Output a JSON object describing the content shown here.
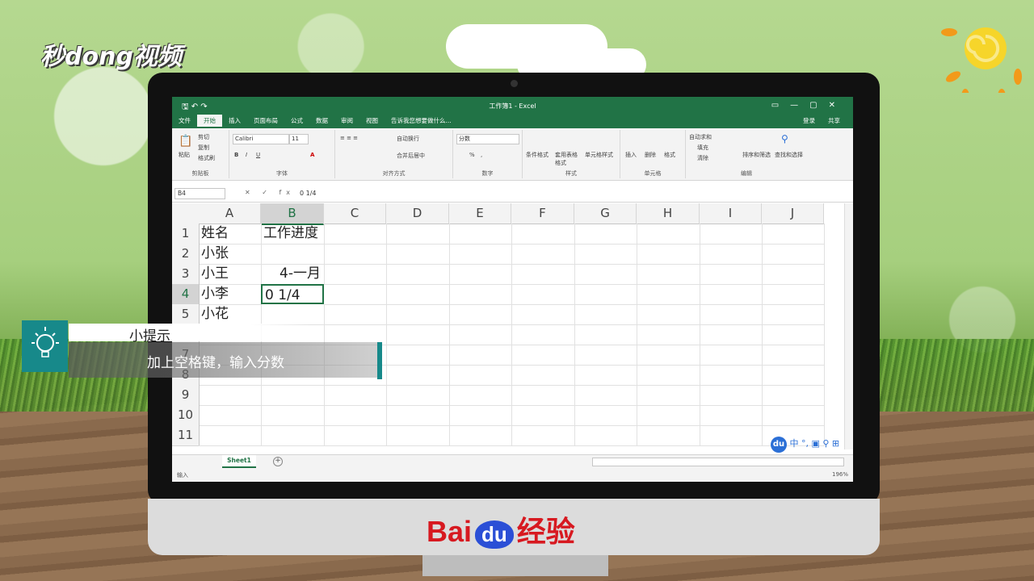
{
  "watermark_top": "秒dong视频",
  "excel": {
    "window_title": "工作簿1 - Excel",
    "tabs": [
      "文件",
      "开始",
      "插入",
      "页面布局",
      "公式",
      "数据",
      "审阅",
      "视图"
    ],
    "active_tab": "开始",
    "tell_me": "告诉我您想要做什么...",
    "sign_in": "登录",
    "share": "共享",
    "ribbon": {
      "clipboard": {
        "label": "剪贴板",
        "paste": "粘贴",
        "cut": "剪切",
        "copy": "复制",
        "format_painter": "格式刷"
      },
      "font": {
        "label": "字体",
        "font_name": "Calibri",
        "font_size": "11",
        "bold": "B",
        "italic": "I",
        "underline": "U"
      },
      "alignment": {
        "label": "对齐方式",
        "wrap_text": "自动换行",
        "merge_center": "合并后居中"
      },
      "number": {
        "label": "数字",
        "format": "分数",
        "percent": "%",
        "comma": ","
      },
      "styles": {
        "label": "样式",
        "conditional": "条件格式",
        "as_table": "套用表格格式",
        "cell_styles": "单元格样式"
      },
      "cells": {
        "label": "单元格",
        "insert": "插入",
        "delete": "删除",
        "format": "格式"
      },
      "editing": {
        "label": "编辑",
        "autosum": "自动求和",
        "fill": "填充",
        "clear": "清除",
        "sort_filter": "排序和筛选",
        "find_select": "查找和选择"
      }
    },
    "name_box": "B4",
    "formula_bar_icons": "✕ ✓ fx",
    "formula_value": "0 1/4",
    "columns": [
      "A",
      "B",
      "C",
      "D",
      "E",
      "F",
      "G",
      "H",
      "I",
      "J"
    ],
    "rows": [
      "1",
      "2",
      "3",
      "4",
      "5",
      "6",
      "7",
      "8",
      "9",
      "10",
      "11"
    ],
    "cells": {
      "A1": "姓名",
      "B1": "工作进度",
      "A2": "小张",
      "A3": "小王",
      "B3": "4-一月",
      "A4": "小李",
      "B4": "0 1/4",
      "A5": "小花"
    },
    "sheet_tab": "Sheet1",
    "status_left": "输入",
    "zoom": "196%",
    "ime": {
      "logo": "du",
      "lang": "中"
    }
  },
  "tip": {
    "title": "小提示",
    "text": "加上空格键，输入分数"
  },
  "brand": {
    "bai": "Bai",
    "du": "du",
    "suffix": "经验"
  }
}
